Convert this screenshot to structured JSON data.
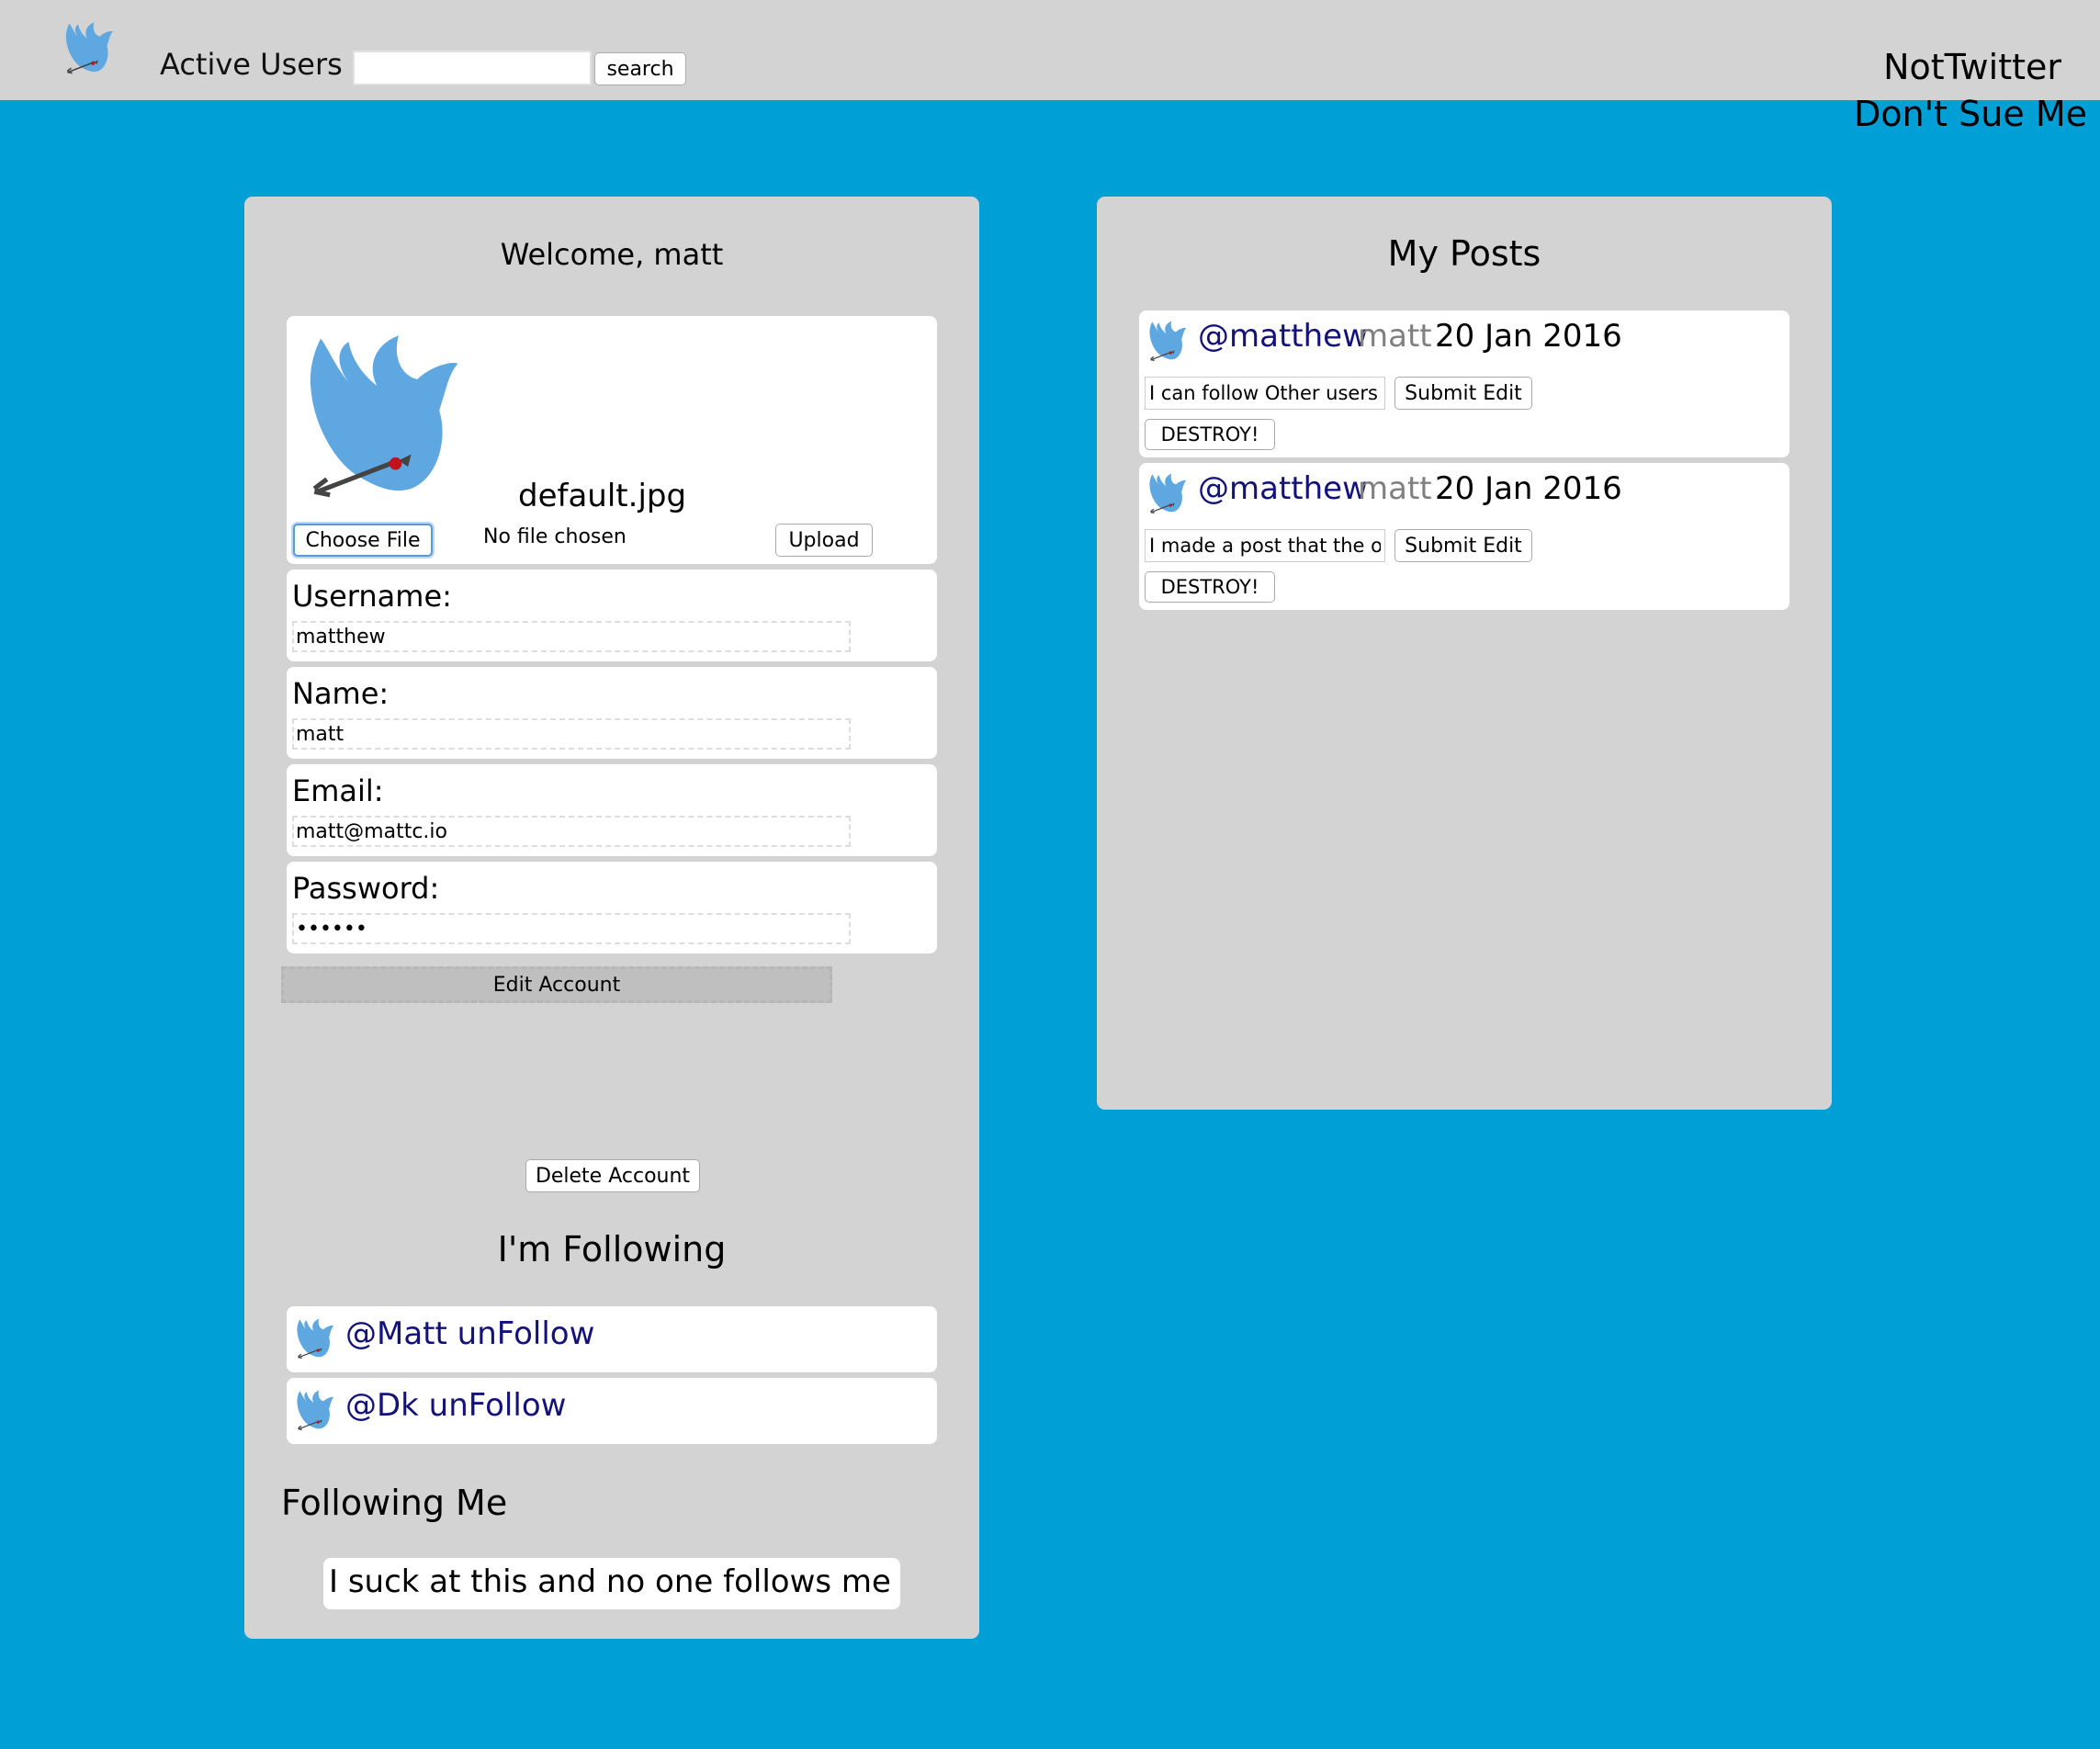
{
  "header": {
    "nav_label": "Active Users",
    "search_placeholder": "",
    "search_button": "search",
    "brand_title": "NotTwitter",
    "brand_subtitle": "Don't Sue Me"
  },
  "account": {
    "welcome": "Welcome, matt",
    "avatar_filename": "default.jpg",
    "choose_file_label": "Choose File",
    "no_file_text": "No file chosen",
    "upload_label": "Upload",
    "fields": {
      "username_label": "Username:",
      "username_value": "matthew",
      "name_label": "Name:",
      "name_value": "matt",
      "email_label": "Email:",
      "email_value": "matt@mattc.io",
      "password_label": "Password:",
      "password_value": "••••••"
    },
    "edit_account_label": "Edit Account",
    "delete_account_label": "Delete Account"
  },
  "following": {
    "title": "I'm Following",
    "items": [
      {
        "label": "@Matt unFollow"
      },
      {
        "label": "@Dk unFollow"
      }
    ]
  },
  "following_me": {
    "title": "Following Me",
    "empty_text": "I suck at this and no one follows me"
  },
  "posts": {
    "title": "My Posts",
    "items": [
      {
        "handle": "@matthew",
        "name": "matt",
        "date": "20 Jan 2016",
        "content": "I can follow Other users!",
        "submit_label": "Submit Edit",
        "destroy_label": "DESTROY!"
      },
      {
        "handle": "@matthew",
        "name": "matt",
        "date": "20 Jan 2016",
        "content": "I made a post that the ot",
        "submit_label": "Submit Edit",
        "destroy_label": "DESTROY!"
      }
    ]
  },
  "colors": {
    "background": "#009fd6",
    "header": "#d3d3d3",
    "panel": "#d3d3d3",
    "link": "#12127a",
    "bird": "#5ea7e0"
  },
  "icons": {
    "logo": "bird-icon",
    "avatar": "bird-arrow-icon"
  }
}
